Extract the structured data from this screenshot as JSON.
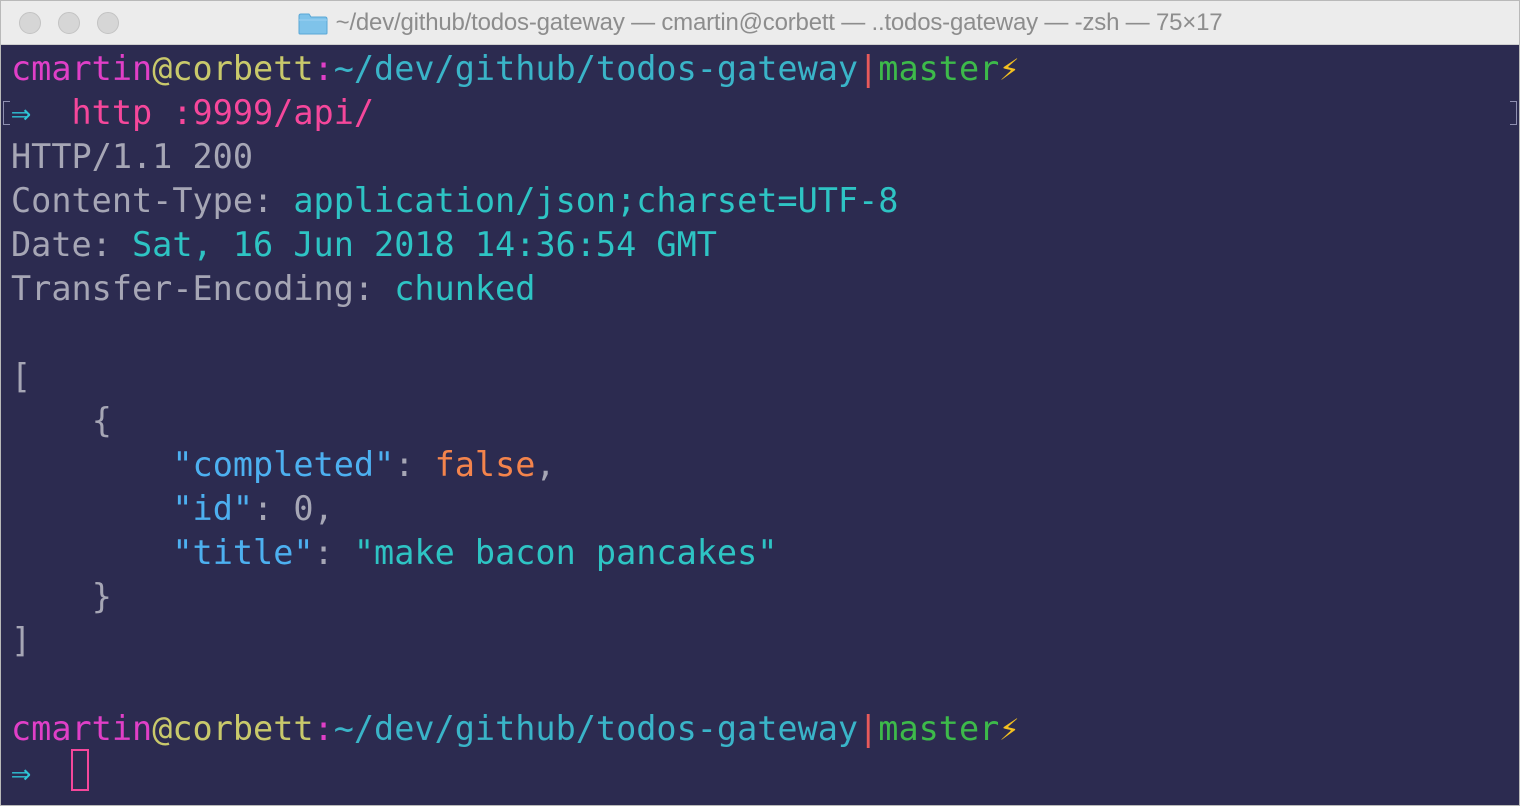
{
  "window": {
    "title": "~/dev/github/todos-gateway — cmartin@corbett — ..todos-gateway — -zsh — 75×17"
  },
  "prompt1": {
    "user": "cmartin",
    "at": "@",
    "host": "corbett",
    "colon": ":",
    "path": "~/dev/github/todos-gateway",
    "bar": "|",
    "branch": "master",
    "bolt": "⚡"
  },
  "command1": {
    "arrow": "⇒",
    "text": "http :9999/api/"
  },
  "response": {
    "status": "HTTP/1.1 200",
    "headers": [
      {
        "name": "Content-Type:",
        "value": "application/json;charset=UTF-8"
      },
      {
        "name": "Date:",
        "value": "Sat, 16 Jun 2018 14:36:54 GMT"
      },
      {
        "name": "Transfer-Encoding:",
        "value": "chunked"
      }
    ],
    "body": {
      "open_bracket": "[",
      "open_brace": "{",
      "fields": [
        {
          "key": "\"completed\"",
          "sep": ": ",
          "value": "false",
          "end": ","
        },
        {
          "key": "\"id\"",
          "sep": ": ",
          "value": "0",
          "end": ","
        },
        {
          "key": "\"title\"",
          "sep": ": ",
          "value": "\"make bacon pancakes\"",
          "end": ""
        }
      ],
      "close_brace": "}",
      "close_bracket": "]"
    }
  },
  "prompt2": {
    "user": "cmartin",
    "at": "@",
    "host": "corbett",
    "colon": ":",
    "path": "~/dev/github/todos-gateway",
    "bar": "|",
    "branch": "master",
    "bolt": "⚡"
  },
  "command2": {
    "arrow": "⇒"
  },
  "colors": {
    "background": "#2c2b50",
    "user": "#e03fc7",
    "host": "#c9c96b",
    "path": "#3ab4c8",
    "branch": "#3dba4a",
    "command": "#f5479b",
    "json_key": "#4db0f0",
    "json_bool": "#f4844c",
    "header_value": "#2ec4c4"
  },
  "icons": {
    "title_folder": "folder-icon",
    "prompt_bolt": "lightning-bolt-icon",
    "prompt_arrow": "double-arrow-right-icon"
  }
}
